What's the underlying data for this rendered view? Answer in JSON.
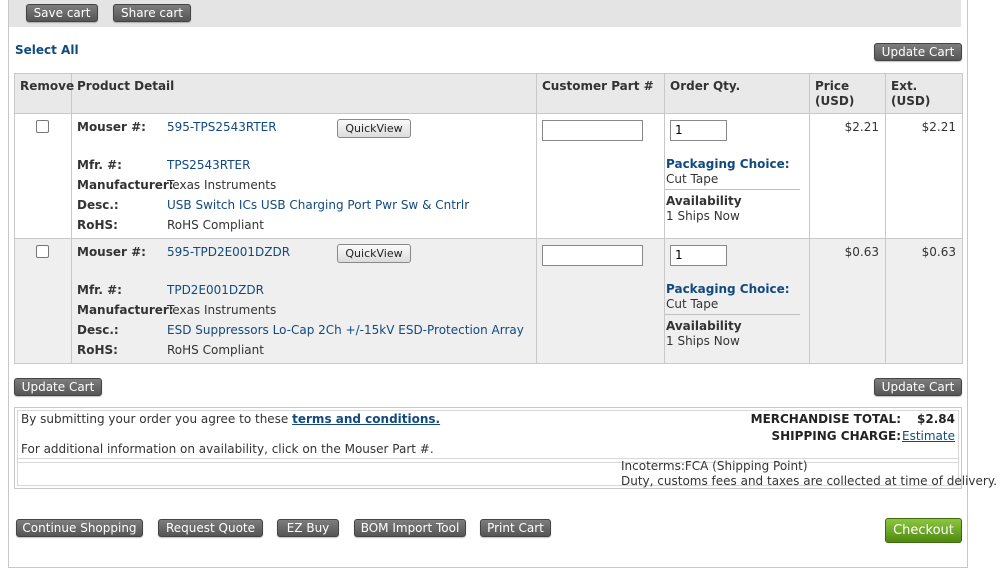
{
  "top_buttons": {
    "save_cart": "Save cart",
    "share_cart": "Share cart"
  },
  "select_all": "Select All",
  "update_cart": "Update Cart",
  "table": {
    "headers": {
      "remove": "Remove",
      "product_detail": "Product Detail",
      "customer_part": "Customer Part #",
      "order_qty": "Order Qty.",
      "price_1": "Price",
      "price_2": "(USD)",
      "ext_1": "Ext.",
      "ext_2": "(USD)"
    },
    "labels": {
      "mouser": "Mouser #:",
      "mfr": "Mfr. #:",
      "manufacturer": "Manufacturer:",
      "desc": "Desc.:",
      "rohs": "RoHS:",
      "quickview": "QuickView",
      "packaging": "Packaging Choice:",
      "availability": "Availability"
    },
    "rows": [
      {
        "mouser": "595-TPS2543RTER",
        "mfr": "TPS2543RTER",
        "manufacturer": "Texas Instruments",
        "desc": "USB Switch ICs USB Charging Port Pwr Sw & Cntrlr",
        "rohs": "RoHS Compliant",
        "qty": "1",
        "packaging": "Cut Tape",
        "availability": "1 Ships Now",
        "price": "$2.21",
        "ext": "$2.21"
      },
      {
        "mouser": "595-TPD2E001DZDR",
        "mfr": "TPD2E001DZDR",
        "manufacturer": "Texas Instruments",
        "desc": "ESD Suppressors Lo-Cap 2Ch +/-15kV ESD-Protection Array",
        "rohs": "RoHS Compliant",
        "qty": "1",
        "packaging": "Cut Tape",
        "availability": "1 Ships Now",
        "price": "$0.63",
        "ext": "$0.63"
      }
    ]
  },
  "terms": {
    "prefix": "By submitting your order you agree to these",
    "link": "terms and conditions.",
    "info": "For additional information on availability, click on the Mouser Part #.",
    "merch_label": "MERCHANDISE TOTAL:",
    "merch_value": "$2.84",
    "ship_label": "SHIPPING CHARGE:",
    "ship_link": "Estimate",
    "incoterms": "Incoterms:FCA (Shipping Point)",
    "duty": "Duty, customs fees and taxes are collected at time of delivery."
  },
  "bottom_buttons": {
    "continue": "Continue Shopping",
    "quote": "Request Quote",
    "ezbuy": "EZ  Buy",
    "bom": "BOM Import Tool",
    "print": "Print Cart",
    "checkout": "Checkout"
  },
  "colors": {
    "link": "#124a7e",
    "checkout": "#5e9c1c",
    "button": "#666666"
  }
}
